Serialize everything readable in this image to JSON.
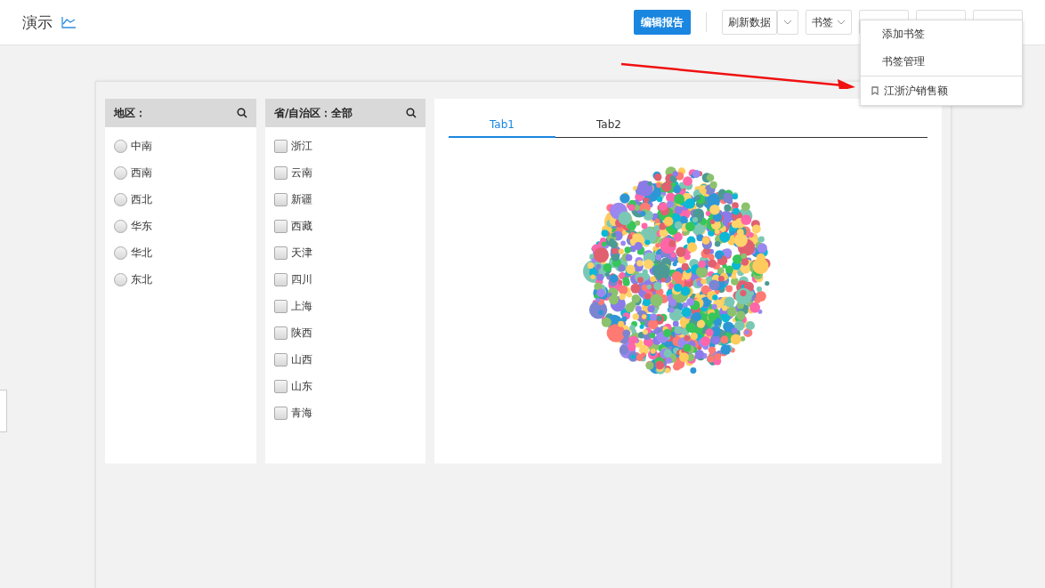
{
  "header": {
    "title": "演示"
  },
  "toolbar": {
    "primary": "编辑报告",
    "refresh": "刷新数据",
    "bookmark": "书签"
  },
  "bookmark_menu": {
    "items": [
      {
        "label": "添加书签",
        "kind": "action"
      },
      {
        "label": "书签管理",
        "kind": "action"
      },
      {
        "label": "江浙沪销售额",
        "kind": "bookmark"
      }
    ]
  },
  "region_filter": {
    "title": "地区：",
    "items": [
      {
        "label": "中南",
        "selected": false
      },
      {
        "label": "西南",
        "selected": false
      },
      {
        "label": "西北",
        "selected": false
      },
      {
        "label": "华东",
        "selected": false
      },
      {
        "label": "华北",
        "selected": false
      },
      {
        "label": "东北",
        "selected": false
      }
    ]
  },
  "province_filter": {
    "title": "省/自治区：全部",
    "items": [
      {
        "label": "浙江",
        "checked": false
      },
      {
        "label": "云南",
        "checked": false
      },
      {
        "label": "新疆",
        "checked": false
      },
      {
        "label": "西藏",
        "checked": false
      },
      {
        "label": "天津",
        "checked": false
      },
      {
        "label": "四川",
        "checked": false
      },
      {
        "label": "上海",
        "checked": false
      },
      {
        "label": "陕西",
        "checked": false
      },
      {
        "label": "山西",
        "checked": false
      },
      {
        "label": "山东",
        "checked": false
      },
      {
        "label": "青海",
        "checked": false
      }
    ]
  },
  "chart_panel": {
    "tabs": [
      {
        "label": "Tab1",
        "selected": true
      },
      {
        "label": "Tab2",
        "selected": false
      }
    ]
  }
}
